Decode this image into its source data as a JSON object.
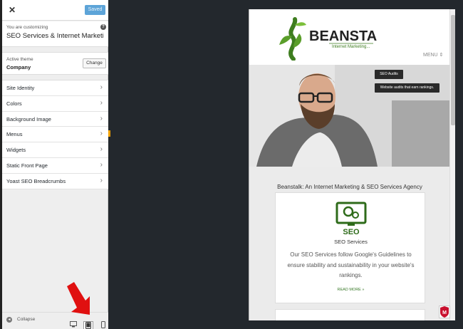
{
  "sidebar": {
    "close_icon": "close-icon",
    "saved_label": "Saved",
    "customizing_label": "You are customizing",
    "site_name": "SEO Services & Internet Marketing",
    "help_glyph": "?",
    "active_theme_label": "Active theme",
    "theme_name": "Company",
    "change_label": "Change",
    "items": [
      {
        "label": "Site Identity"
      },
      {
        "label": "Colors"
      },
      {
        "label": "Background Image"
      },
      {
        "label": "Menus"
      },
      {
        "label": "Widgets"
      },
      {
        "label": "Static Front Page"
      },
      {
        "label": "Yoast SEO Breadcrumbs"
      }
    ],
    "collapse_label": "Collapse",
    "devices": [
      "desktop-icon",
      "tablet-icon",
      "mobile-icon"
    ],
    "active_device": "tablet"
  },
  "preview": {
    "logo_text": "BEANSTALK",
    "logo_tagline": "Internet Marketing...",
    "menu_label": "MENU ⇕",
    "hero_tip_1": "SEO Audits",
    "hero_tip_2": "Website audits that earn rankings.",
    "page_title": "Beanstalk: An Internet Marketing & SEO Services Agency",
    "card": {
      "icon_text": "SEO",
      "title": "SEO Services",
      "text": "Our SEO Services follow Google's Guidelines to ensure stability and sustainability in your website's rankings.",
      "read_more": "READ MORE »"
    },
    "badge_letter": "M"
  },
  "colors": {
    "accent_blue": "#5da4d8",
    "brand_green": "#3e7d1f",
    "annotation_red": "#e01010",
    "frame_dark": "#23282d"
  }
}
